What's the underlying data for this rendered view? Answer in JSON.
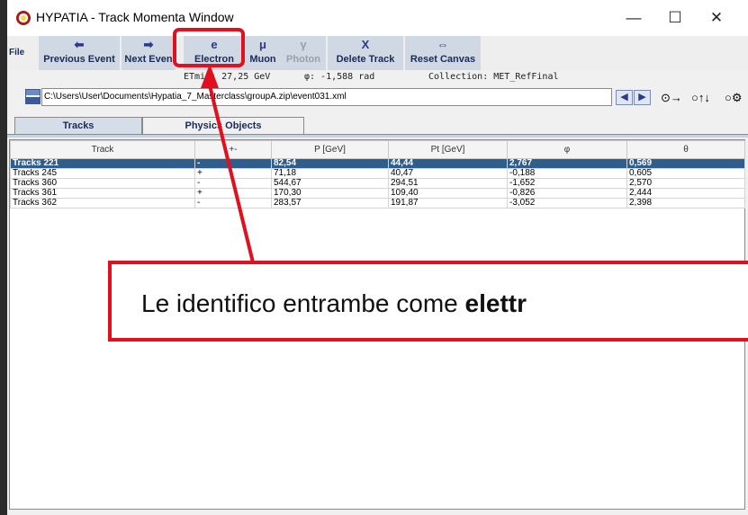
{
  "window": {
    "title": "HYPATIA - Track Momenta Window",
    "minimize": "—",
    "maximize": "☐",
    "close": "✕"
  },
  "toolbar": {
    "file_menu": "File",
    "buttons": [
      {
        "label": "Previous Event",
        "icon": "⬅",
        "enabled": true
      },
      {
        "label": "Next Even",
        "icon": "➡",
        "enabled": true
      },
      {
        "label": "Electron",
        "icon": "e",
        "enabled": true
      },
      {
        "label": "Muon",
        "icon": "μ",
        "enabled": true
      },
      {
        "label": "Photon",
        "icon": "γ",
        "enabled": false
      },
      {
        "label": "Delete Track",
        "icon": "X",
        "enabled": true
      },
      {
        "label": "Reset Canvas",
        "icon": "⇔",
        "enabled": true
      }
    ]
  },
  "info": {
    "etmiss": "ETmis: 27,25 GeV",
    "phi": "φ: -1,588 rad",
    "collection": "Collection: MET_RefFinal"
  },
  "path": {
    "value": "C:\\Users\\User\\Documents\\Hypatia_7_Masterclass\\groupA.zip\\event031.xml",
    "prev_icon": "◀",
    "next_icon": "▶",
    "tool1": "⊙→",
    "tool2": "○↑↓",
    "tool3": "○⚙"
  },
  "tabs": [
    {
      "label": "Tracks",
      "active": true
    },
    {
      "label": "Physics Objects",
      "active": false
    }
  ],
  "table": {
    "columns": [
      "Track",
      "+-",
      "P [GeV]",
      "Pt [GeV]",
      "φ",
      "θ"
    ],
    "rows": [
      {
        "track": "Tracks 221",
        "charge": "-",
        "p": "82,54",
        "pt": "44,44",
        "phi": "2,767",
        "theta": "0,569",
        "selected": true
      },
      {
        "track": "Tracks 245",
        "charge": "+",
        "p": "71,18",
        "pt": "40,47",
        "phi": "-0,188",
        "theta": "0,605",
        "selected": false
      },
      {
        "track": "Tracks 360",
        "charge": "-",
        "p": "544,67",
        "pt": "294,51",
        "phi": "-1,652",
        "theta": "2,570",
        "selected": false
      },
      {
        "track": "Tracks 361",
        "charge": "+",
        "p": "170,30",
        "pt": "109,40",
        "phi": "-0,826",
        "theta": "2,444",
        "selected": false
      },
      {
        "track": "Tracks 362",
        "charge": "-",
        "p": "283,57",
        "pt": "191,87",
        "phi": "-3,052",
        "theta": "2,398",
        "selected": false
      }
    ]
  },
  "annotation": {
    "text_before": "Le identifico entrambe come ",
    "text_bold": "elettr",
    "color": "#e0101e"
  }
}
